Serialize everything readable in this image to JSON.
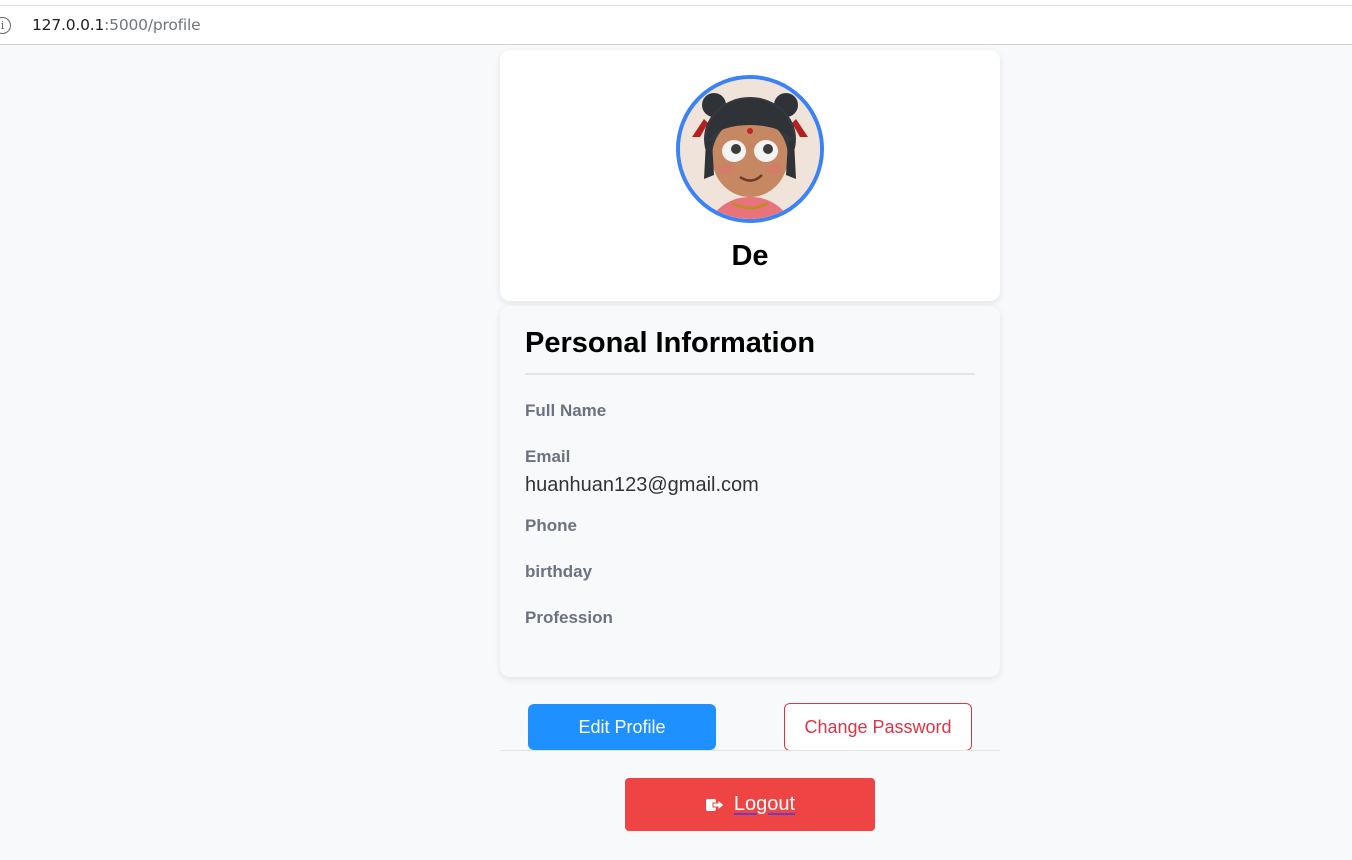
{
  "browser": {
    "url_host": "127.0.0.1",
    "url_rest": ":5000/profile",
    "info_icon": "info-icon"
  },
  "profile": {
    "username": "De",
    "avatar_icon": "avatar"
  },
  "personal_info": {
    "title": "Personal Information",
    "fields": [
      {
        "label": "Full Name",
        "value": ""
      },
      {
        "label": "Email",
        "value": "huanhuan123@gmail.com"
      },
      {
        "label": "Phone",
        "value": ""
      },
      {
        "label": "birthday",
        "value": ""
      },
      {
        "label": "Profession",
        "value": ""
      }
    ]
  },
  "actions": {
    "edit_label": "Edit Profile",
    "change_password_label": "Change Password",
    "logout_label": "Logout",
    "logout_icon": "logout-icon"
  },
  "colors": {
    "accent_blue": "#1e90ff",
    "avatar_ring": "#3b82f6",
    "danger": "#dc3545",
    "logout_bg": "#ef4444"
  }
}
